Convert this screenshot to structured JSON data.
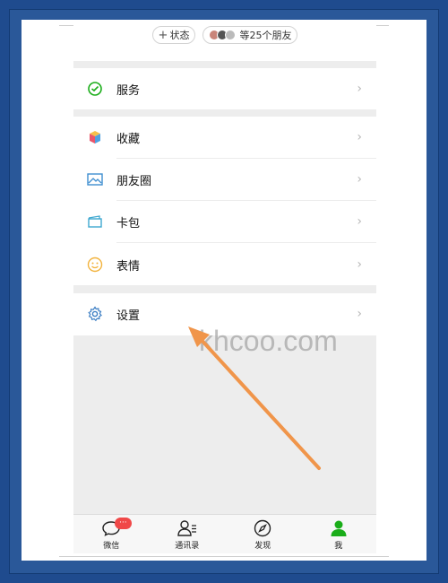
{
  "status_row": {
    "add_status_plus": "+",
    "add_status_label": "状态",
    "friends_label": "等25个朋友"
  },
  "menu": {
    "services": "服务",
    "favorites": "收藏",
    "moments": "朋友圈",
    "cards": "卡包",
    "stickers": "表情",
    "settings": "设置"
  },
  "watermark": "khcoo.com",
  "tabbar": {
    "chats": "微信",
    "chats_badge": "···",
    "contacts": "通讯录",
    "discover": "发现",
    "me": "我"
  },
  "colors": {
    "accent_green": "#1aad19",
    "arrow_orange": "#f0954a",
    "badge_red": "#f04848",
    "frame_blue": "#1f4b8e"
  },
  "icons": {
    "services": "wechat-pay-icon",
    "favorites": "cube-icon",
    "moments": "image-icon",
    "cards": "wallet-icon",
    "stickers": "smile-icon",
    "settings": "gear-icon"
  }
}
